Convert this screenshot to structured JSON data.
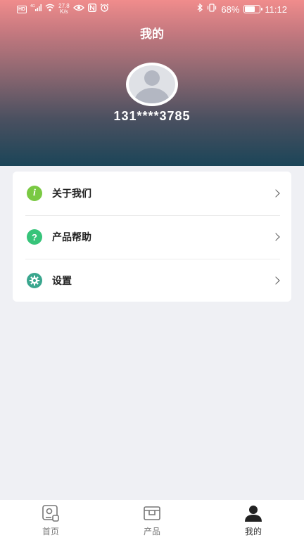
{
  "status_bar": {
    "hd": "HD",
    "network": "4G",
    "speed_value": "27.8",
    "speed_unit": "K/s",
    "battery_percent": "68%",
    "battery_level": 0.68,
    "time": "11:12"
  },
  "header": {
    "title": "我的",
    "phone": "131****3785"
  },
  "menu": {
    "items": [
      {
        "label": "关于我们",
        "icon": "info-icon"
      },
      {
        "label": "产品帮助",
        "icon": "help-icon"
      },
      {
        "label": "设置",
        "icon": "gear-icon"
      }
    ]
  },
  "tabbar": {
    "tabs": [
      {
        "label": "首页",
        "icon": "home-icon"
      },
      {
        "label": "产品",
        "icon": "product-icon"
      },
      {
        "label": "我的",
        "icon": "profile-icon"
      }
    ],
    "active": "我的"
  },
  "colors": {
    "header_top": "#f08c8c",
    "header_bottom": "#1b4558",
    "info_icon": "#7ac943",
    "help_icon": "#37c47a",
    "gear_icon": "#3aa68e",
    "page_bg": "#eff0f4"
  }
}
